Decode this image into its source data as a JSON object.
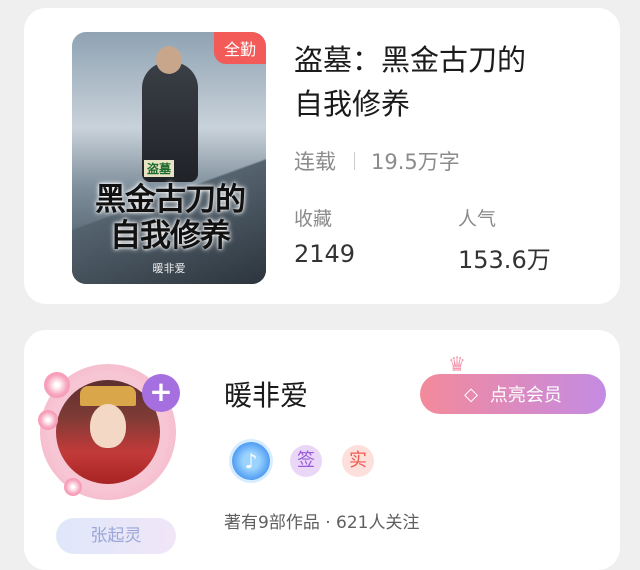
{
  "book": {
    "cover_title": "黑金古刀的自我修养",
    "cover_small": "盗墓",
    "cover_author": "暖非爱",
    "badge": "全勤",
    "title_line1": "盗墓：黑金古刀的",
    "title_line2": "自我修养",
    "status": "连载",
    "word_count": "19.5万字",
    "collect_label": "收藏",
    "collect_value": "2149",
    "popularity_label": "人气",
    "popularity_value": "153.6万"
  },
  "author": {
    "name": "暖非爱",
    "follow_icon": "+",
    "signature": "张起灵",
    "vip_button": "点亮会员",
    "badge_sign": "签",
    "badge_real": "实",
    "works_info": "著有9部作品 · 621人关注"
  },
  "icons": {
    "crown": "crown-icon",
    "diamond": "diamond-icon",
    "music": "music-badge-icon"
  },
  "colors": {
    "badge_red": "#f25b57",
    "vip_start": "#f48a9b",
    "vip_end": "#c48be3",
    "follow_purple": "#a56fe0"
  }
}
